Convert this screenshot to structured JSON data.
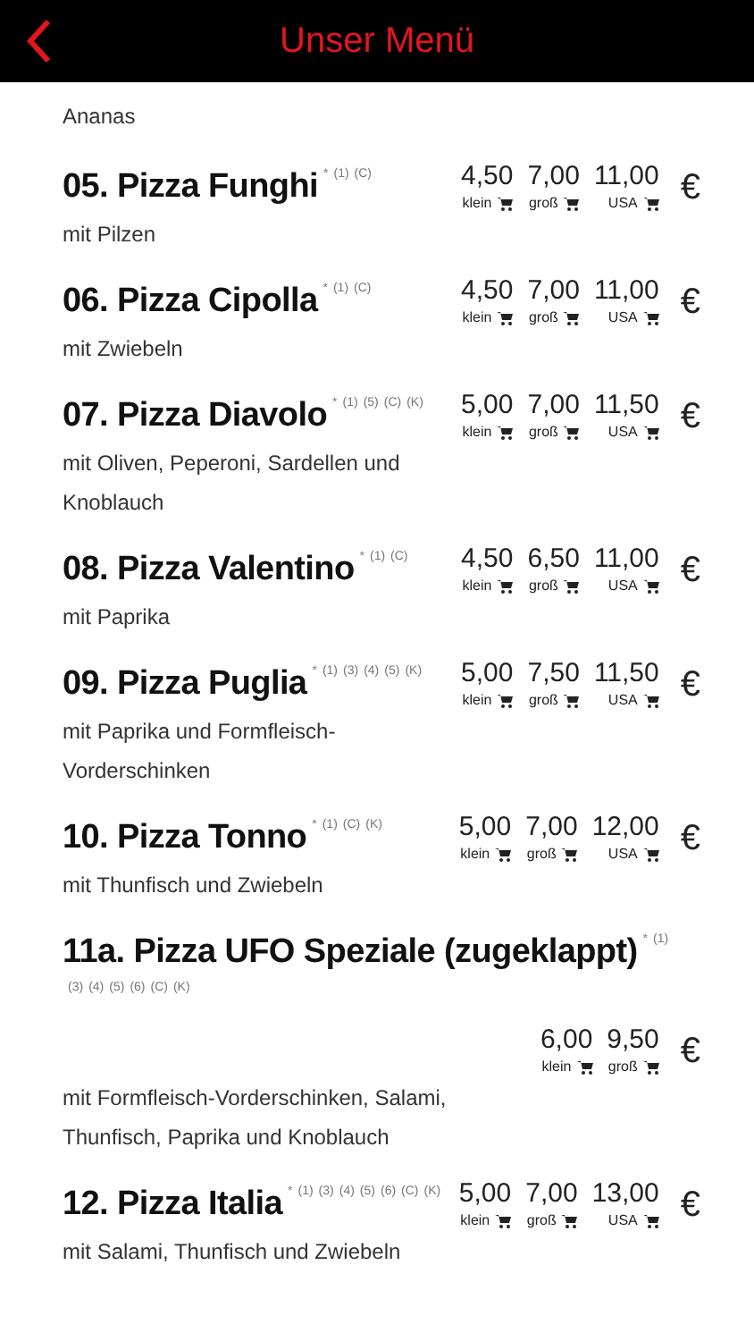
{
  "header": {
    "title": "Unser Menü"
  },
  "intro_text": "Ananas",
  "items": [
    {
      "title": "05. Pizza Funghi",
      "notes": [
        "*",
        "(1)",
        "(C)"
      ],
      "description": "mit Pilzen",
      "prices": [
        {
          "amount": "4,50",
          "size": "klein"
        },
        {
          "amount": "7,00",
          "size": "groß"
        },
        {
          "amount": "11,00",
          "size": "USA"
        }
      ],
      "currency": "€"
    },
    {
      "title": "06. Pizza Cipolla",
      "notes": [
        "*",
        "(1)",
        "(C)"
      ],
      "description": "mit Zwiebeln",
      "prices": [
        {
          "amount": "4,50",
          "size": "klein"
        },
        {
          "amount": "7,00",
          "size": "groß"
        },
        {
          "amount": "11,00",
          "size": "USA"
        }
      ],
      "currency": "€"
    },
    {
      "title": "07. Pizza Diavolo",
      "notes": [
        "*",
        "(1)",
        "(5)",
        "(C)",
        "(K)"
      ],
      "description": "mit Oliven, Peperoni, Sardellen und Knoblauch",
      "prices": [
        {
          "amount": "5,00",
          "size": "klein"
        },
        {
          "amount": "7,00",
          "size": "groß"
        },
        {
          "amount": "11,50",
          "size": "USA"
        }
      ],
      "currency": "€"
    },
    {
      "title": "08. Pizza Valentino",
      "notes": [
        "*",
        "(1)",
        "(C)"
      ],
      "description": "mit Paprika",
      "prices": [
        {
          "amount": "4,50",
          "size": "klein"
        },
        {
          "amount": "6,50",
          "size": "groß"
        },
        {
          "amount": "11,00",
          "size": "USA"
        }
      ],
      "currency": "€"
    },
    {
      "title": "09. Pizza Puglia",
      "notes": [
        "*",
        "(1)",
        "(3)",
        "(4)",
        "(5)",
        "(K)"
      ],
      "description": "mit Paprika und Formfleisch-Vorderschinken",
      "prices": [
        {
          "amount": "5,00",
          "size": "klein"
        },
        {
          "amount": "7,50",
          "size": "groß"
        },
        {
          "amount": "11,50",
          "size": "USA"
        }
      ],
      "currency": "€"
    },
    {
      "title": "10. Pizza Tonno",
      "notes": [
        "*",
        "(1)",
        "(C)",
        "(K)"
      ],
      "description": "mit Thunfisch und Zwiebeln",
      "prices": [
        {
          "amount": "5,00",
          "size": "klein"
        },
        {
          "amount": "7,00",
          "size": "groß"
        },
        {
          "amount": "12,00",
          "size": "USA"
        }
      ],
      "currency": "€"
    },
    {
      "title": "11a. Pizza UFO Speziale (zugeklappt)",
      "notes": [
        "*",
        "(1)",
        "(3)",
        "(4)",
        "(5)",
        "(6)",
        "(C)",
        "(K)"
      ],
      "description": "mit Formfleisch-Vorderschinken, Salami, Thunfisch, Paprika und Knoblauch",
      "prices": [
        {
          "amount": "6,00",
          "size": "klein"
        },
        {
          "amount": "9,50",
          "size": "groß"
        }
      ],
      "currency": "€"
    },
    {
      "title": "12. Pizza Italia",
      "notes": [
        "*",
        "(1)",
        "(3)",
        "(4)",
        "(5)",
        "(6)",
        "(C)",
        "(K)"
      ],
      "description": "mit Salami, Thunfisch und Zwiebeln",
      "prices": [
        {
          "amount": "5,00",
          "size": "klein"
        },
        {
          "amount": "7,00",
          "size": "groß"
        },
        {
          "amount": "13,00",
          "size": "USA"
        }
      ],
      "currency": "€"
    }
  ]
}
